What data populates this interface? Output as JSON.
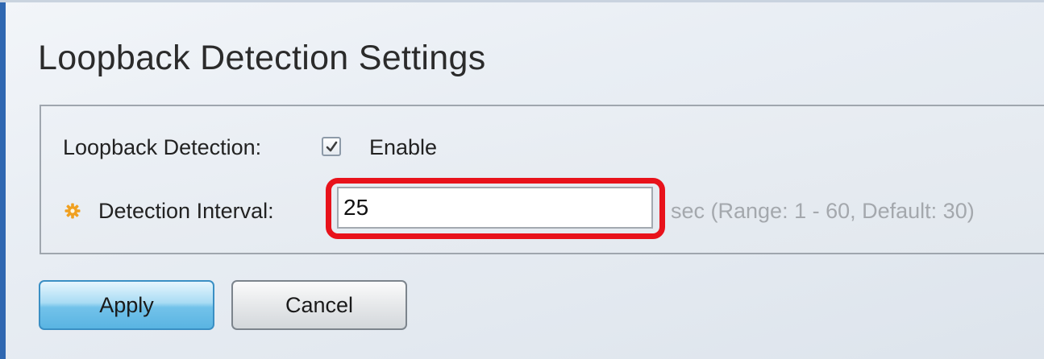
{
  "page": {
    "title": "Loopback Detection Settings"
  },
  "settings": {
    "loopback_detection": {
      "label": "Loopback Detection:",
      "checkbox_label": "Enable",
      "checked": true
    },
    "detection_interval": {
      "label": "Detection Interval:",
      "value": "25",
      "hint": "sec (Range: 1 - 60, Default: 30)",
      "required_icon": "gear-icon"
    }
  },
  "buttons": {
    "apply_label": "Apply",
    "cancel_label": "Cancel"
  },
  "colors": {
    "accent_edge": "#2f67b1",
    "highlight": "#e8121b",
    "required_icon": "#f0a020",
    "apply_button": "#5ab4e2"
  }
}
